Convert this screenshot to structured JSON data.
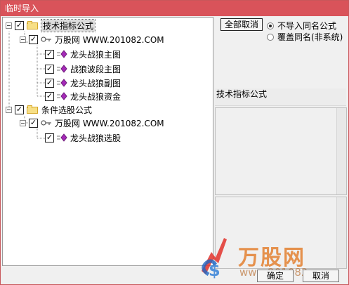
{
  "window": {
    "title": "临时导入"
  },
  "tree": {
    "groups": [
      {
        "label": "技术指标公式",
        "checked": true,
        "selected": true,
        "source": {
          "label": "万股网 WWW.201082.COM",
          "checked": true
        },
        "items": [
          {
            "label": "龙头战狼主图",
            "checked": true
          },
          {
            "label": "战狼波段主图",
            "checked": true
          },
          {
            "label": "龙头战狼副图",
            "checked": true
          },
          {
            "label": "龙头战狼资金",
            "checked": true
          }
        ]
      },
      {
        "label": "条件选股公式",
        "checked": true,
        "selected": false,
        "source": {
          "label": "万股网 WWW.201082.COM",
          "checked": true
        },
        "items": [
          {
            "label": "龙头战狼选股",
            "checked": true
          }
        ]
      }
    ]
  },
  "controls": {
    "deselect_all": "全部取消",
    "option_no_import": "不导入同名公式",
    "option_overwrite": "覆盖同名(非系统)",
    "selected_option": "option_no_import"
  },
  "details": {
    "title": "技术指标公式"
  },
  "buttons": {
    "ok": "确定",
    "cancel": "取消"
  },
  "watermark": {
    "brand": "万股网",
    "url": "www.201082.com"
  },
  "colors": {
    "titlebar": "#d9535a",
    "formula_icon": "#a52ab8",
    "watermark": "#e37d2a"
  }
}
